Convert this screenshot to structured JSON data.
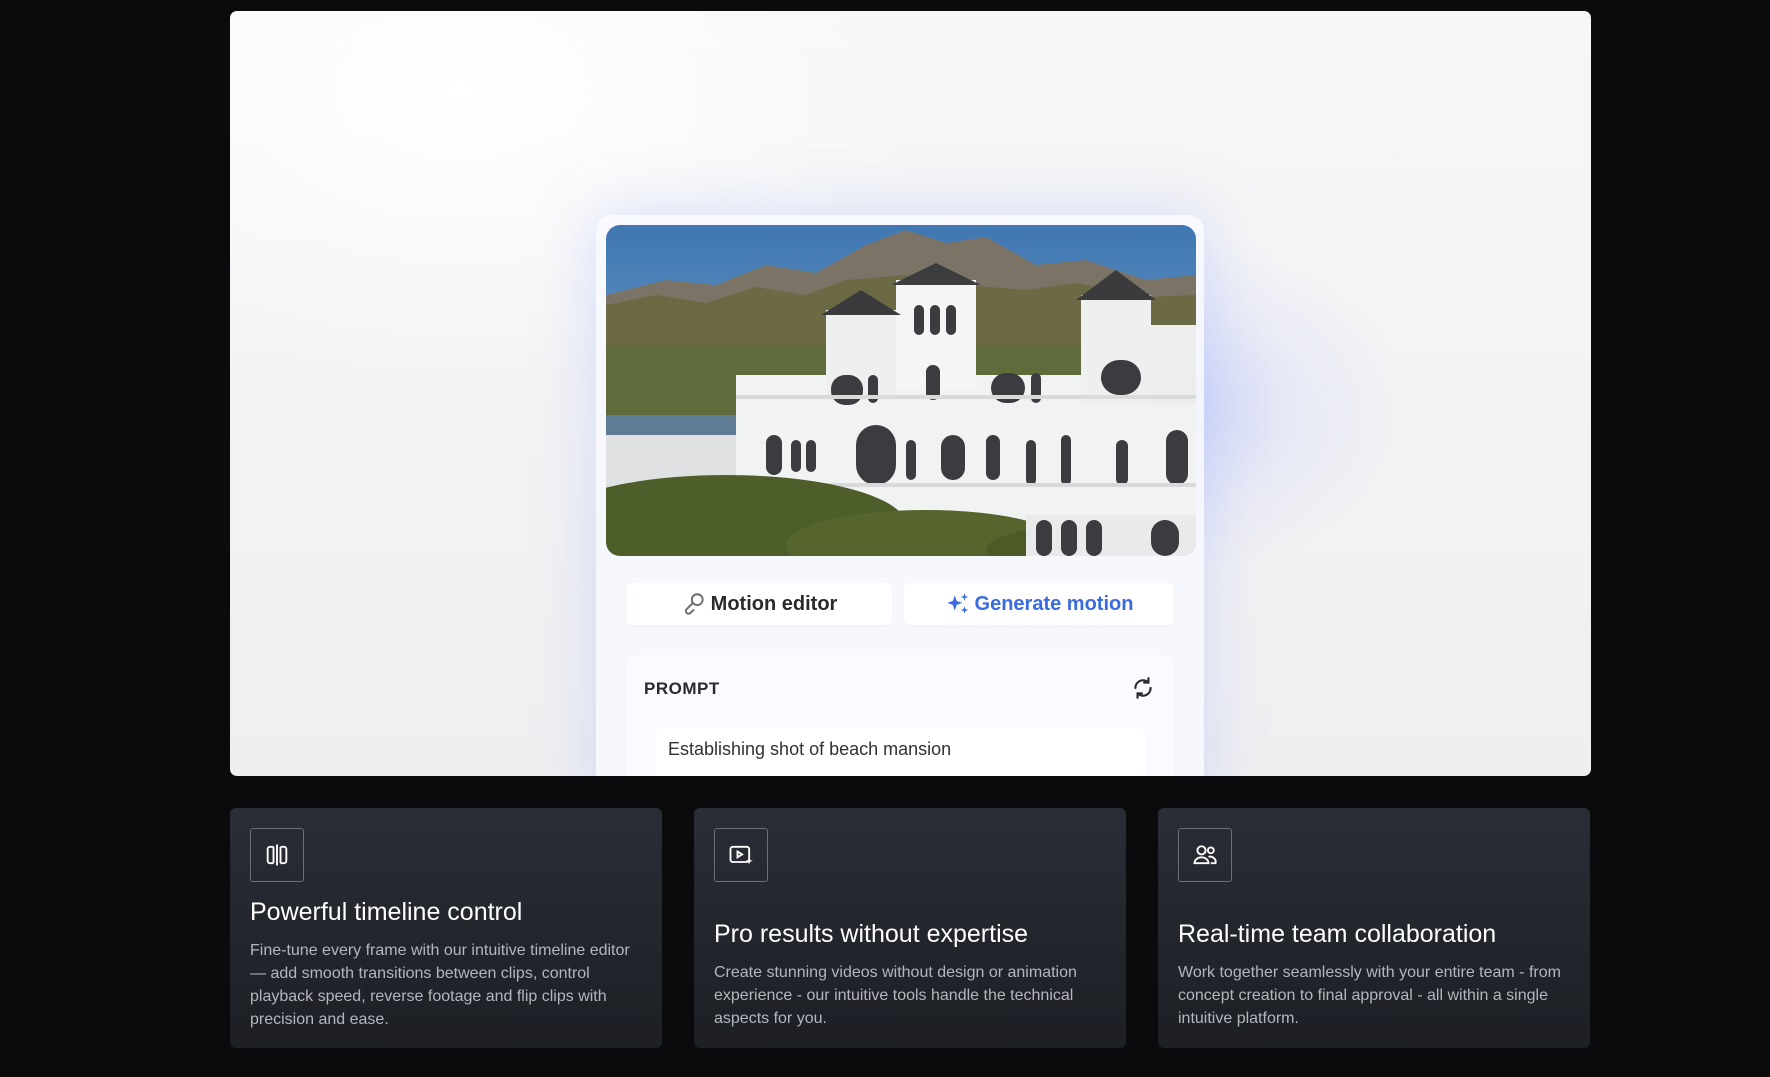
{
  "hero": {
    "tabs": {
      "motion_editor": "Motion editor",
      "generate_motion": "Generate motion"
    },
    "prompt": {
      "label": "PROMPT",
      "text": "Establishing shot of beach mansion"
    },
    "icons": {
      "motion_editor": "link-icon",
      "generate_motion": "sparkles-icon",
      "refresh": "refresh-icon"
    },
    "colors": {
      "accent": "#3a6be0"
    }
  },
  "features": [
    {
      "icon": "split-timeline-icon",
      "title": "Powerful timeline control",
      "description": "Fine-tune every frame with our intuitive timeline editor — add smooth transitions between clips, control playback speed, reverse footage and flip clips with precision and ease."
    },
    {
      "icon": "video-sparkle-icon",
      "title": "Pro results without expertise",
      "description": "Create stunning videos without design or animation experience - our intuitive tools handle the technical aspects for you."
    },
    {
      "icon": "team-icon",
      "title": "Real-time team collaboration",
      "description": "Work together seamlessly with your entire team - from concept creation to final approval - all within a single intuitive platform."
    }
  ]
}
